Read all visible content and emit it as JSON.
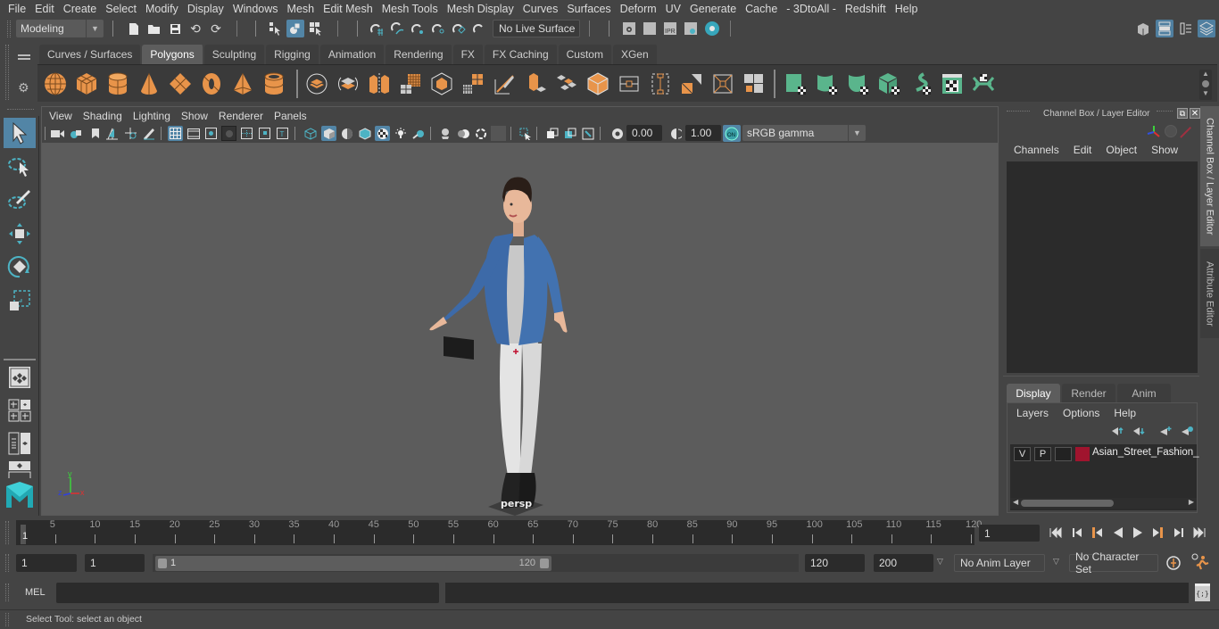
{
  "menubar": {
    "items": [
      "File",
      "Edit",
      "Create",
      "Select",
      "Modify",
      "Display",
      "Windows",
      "Mesh",
      "Edit Mesh",
      "Mesh Tools",
      "Mesh Display",
      "Curves",
      "Surfaces",
      "Deform",
      "UV",
      "Generate",
      "Cache",
      "- 3DtoAll -",
      "Redshift",
      "Help"
    ]
  },
  "statusline": {
    "workspace": "Modeling",
    "live_surface": "No Live Surface"
  },
  "shelf": {
    "tabs": [
      "Curves / Surfaces",
      "Polygons",
      "Sculpting",
      "Rigging",
      "Animation",
      "Rendering",
      "FX",
      "FX Caching",
      "Custom",
      "XGen"
    ],
    "active_tab": "Polygons",
    "icons_orange": [
      "poly-sphere-icon",
      "poly-cube-icon",
      "poly-cylinder-icon",
      "poly-cone-icon",
      "poly-plane-icon",
      "poly-torus-icon",
      "poly-pyramid-icon",
      "poly-pipe-icon"
    ],
    "icons_tools": [
      "combine-icon",
      "separate-icon",
      "mirror-icon",
      "smooth-icon",
      "reduce-icon",
      "extract-icon",
      "multi-cut-icon",
      "extrude-icon",
      "bridge-icon",
      "bevel-icon",
      "bevel-box-icon",
      "append-poly-icon",
      "merge-icon",
      "target-weld-icon",
      "fill-hole-icon"
    ],
    "icons_green": [
      "planar-uv-icon",
      "cylindrical-uv-icon",
      "spherical-uv-icon",
      "automatic-uv-icon",
      "unfold-uv-icon",
      "uv-editor-icon",
      "layout-uv-icon"
    ]
  },
  "viewport": {
    "menu": [
      "View",
      "Shading",
      "Lighting",
      "Show",
      "Renderer",
      "Panels"
    ],
    "exposure": "0.00",
    "gamma": "1.00",
    "color_mgmt": "ON",
    "colorspace": "sRGB gamma",
    "camera_label": "persp",
    "axis": {
      "x": "x",
      "y": "y",
      "z": "z"
    }
  },
  "channel_box": {
    "title": "Channel Box / Layer Editor",
    "menu": [
      "Channels",
      "Edit",
      "Object",
      "Show"
    ],
    "layer_tabs": [
      "Display",
      "Render",
      "Anim"
    ],
    "active_layer_tab": "Display",
    "layer_menu": [
      "Layers",
      "Options",
      "Help"
    ],
    "layers": [
      {
        "v": "V",
        "p": "P",
        "color": "#a0142e",
        "name": "Asian_Street_Fashion_"
      }
    ],
    "side_tabs": [
      "Channel Box / Layer Editor",
      "Attribute Editor"
    ]
  },
  "timeline": {
    "start_tick": "1",
    "ticks": [
      5,
      10,
      15,
      20,
      25,
      30,
      35,
      40,
      45,
      50,
      55,
      60,
      65,
      70,
      75,
      80,
      85,
      90,
      95,
      100,
      105,
      110,
      115,
      120
    ],
    "current_frame": "1"
  },
  "range": {
    "start": "1",
    "playback_start": "1",
    "slider_min": "1",
    "slider_max": "120",
    "playback_end": "120",
    "end": "200",
    "anim_layer": "No Anim Layer",
    "character_set": "No Character Set"
  },
  "command": {
    "lang": "MEL"
  },
  "helpline": {
    "text": "Select Tool: select an object"
  }
}
